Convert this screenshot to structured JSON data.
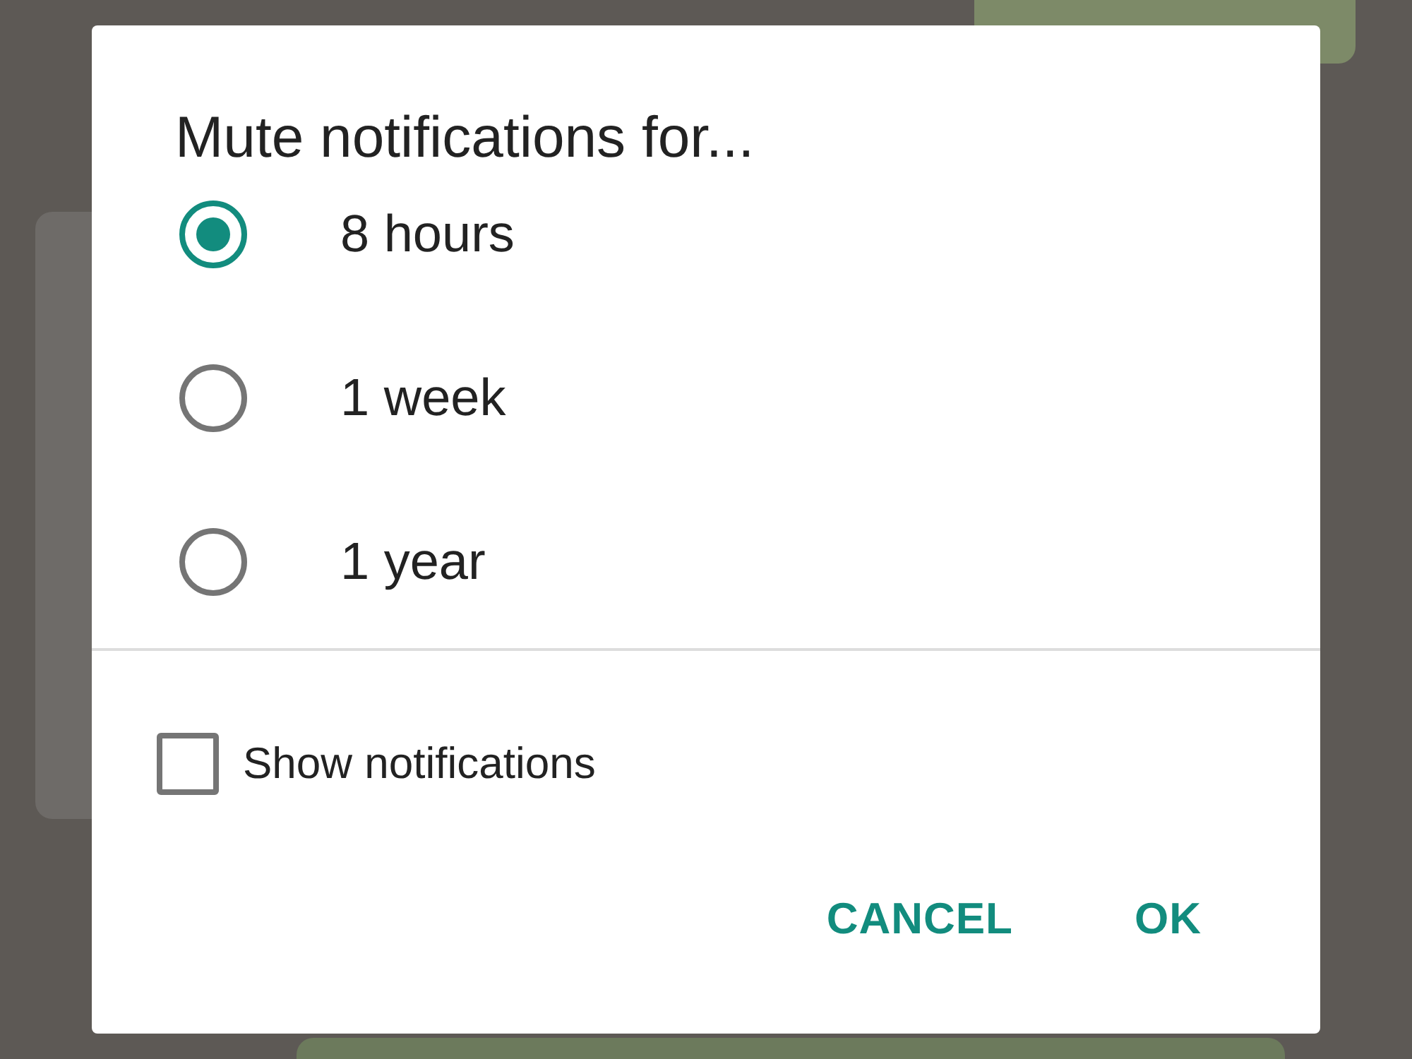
{
  "dialog": {
    "title": "Mute notifications for...",
    "options": [
      {
        "label": "8 hours",
        "selected": true
      },
      {
        "label": "1 week",
        "selected": false
      },
      {
        "label": "1 year",
        "selected": false
      }
    ],
    "show_notifications": {
      "label": "Show notifications",
      "checked": false
    },
    "buttons": [
      "CANCEL",
      "OK"
    ]
  }
}
